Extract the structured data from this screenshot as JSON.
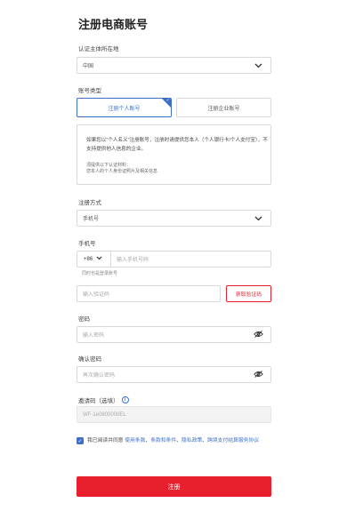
{
  "page": {
    "title": "注册电商账号"
  },
  "region": {
    "label": "认证主体所在地",
    "value": "中国"
  },
  "account_type": {
    "label": "账号类型",
    "options": [
      "注册个人账号",
      "注册企业账号"
    ],
    "selected": "注册个人账号",
    "info_text": "如果您以“个人名义”注册账号，注册时请提供您本人（个人银行卡/个人支付宝），不支持提供他人信息的企业。",
    "requirements": [
      "须提供以下认证材料：",
      "您本人的个人身份证照片及相关信息"
    ]
  },
  "register_method": {
    "label": "注册方式",
    "value": "手机号"
  },
  "phone": {
    "label": "手机号",
    "country_code": "+86",
    "placeholder": "输入手机号码",
    "hint": "同时也是登录账号"
  },
  "verification": {
    "placeholder": "输入验证码",
    "button_label": "获取验证码"
  },
  "password": {
    "label": "密码",
    "placeholder": "输入密码"
  },
  "confirm_password": {
    "label": "确认密码",
    "placeholder": "再次确认密码"
  },
  "invite": {
    "label": "邀请码（选填）",
    "value": "WF-1e0800000EL"
  },
  "agreement": {
    "prefix": "我已阅读并同意",
    "links": [
      "使用条款",
      "条款和条件",
      "隐私政策",
      "跨境支付结算服务协议"
    ]
  },
  "submit": {
    "label": "注册"
  },
  "colors": {
    "primary_red": "#e8202e",
    "accent_blue": "#3d6fc6"
  }
}
